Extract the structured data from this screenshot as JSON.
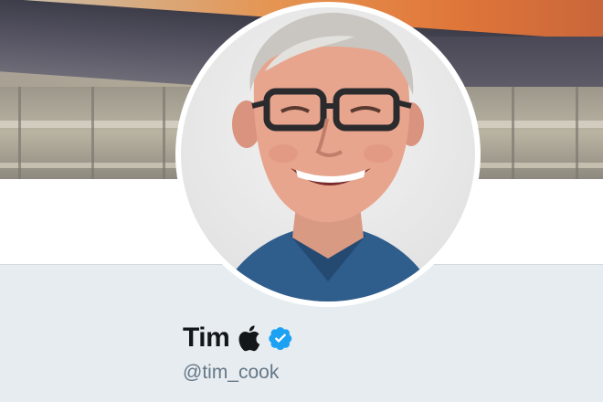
{
  "profile": {
    "display_name": "Tim",
    "handle": "@tim_cook",
    "name_emoji_icon": "apple-logo-icon",
    "verified_icon": "verified-badge-icon"
  },
  "colors": {
    "page_background": "#e6ecf0",
    "verified_blue": "#1da1f2",
    "name_text": "#14171a",
    "handle_text": "#657786"
  }
}
